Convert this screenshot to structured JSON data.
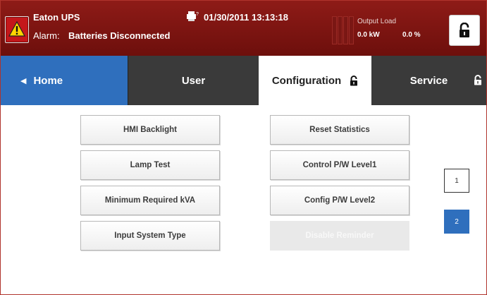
{
  "header": {
    "system_name": "Eaton UPS",
    "alarm_prefix": "Alarm:",
    "alarm_text": "Batteries Disconnected",
    "datetime": "01/30/2011 13:13:18",
    "output_load_label": "Output Load",
    "output_kw": "0.0 kW",
    "output_percent": "0.0 %"
  },
  "tabs": [
    {
      "label": "Home",
      "selected": false
    },
    {
      "label": "User",
      "selected": false
    },
    {
      "label": "Configuration",
      "selected": true
    },
    {
      "label": "Service",
      "selected": false
    }
  ],
  "buttons": {
    "left": [
      "HMI Backlight",
      "Lamp Test",
      "Minimum Required kVA",
      "Input System Type"
    ],
    "right": [
      "Reset Statistics",
      "Control P/W Level1",
      "Config P/W Level2",
      "Disable Reminder"
    ]
  },
  "pagination": {
    "pages": [
      "1",
      "2"
    ],
    "current": "2"
  },
  "colors": {
    "header_red": "#8e1b17",
    "alarm_red": "#c4171b",
    "home_blue": "#2f6fbd",
    "tab_dark": "#3a3a3a",
    "warning_yellow": "#ffd400"
  },
  "icons": [
    "warning-icon",
    "printer-icon",
    "load-bars-icon",
    "lock-icon"
  ]
}
